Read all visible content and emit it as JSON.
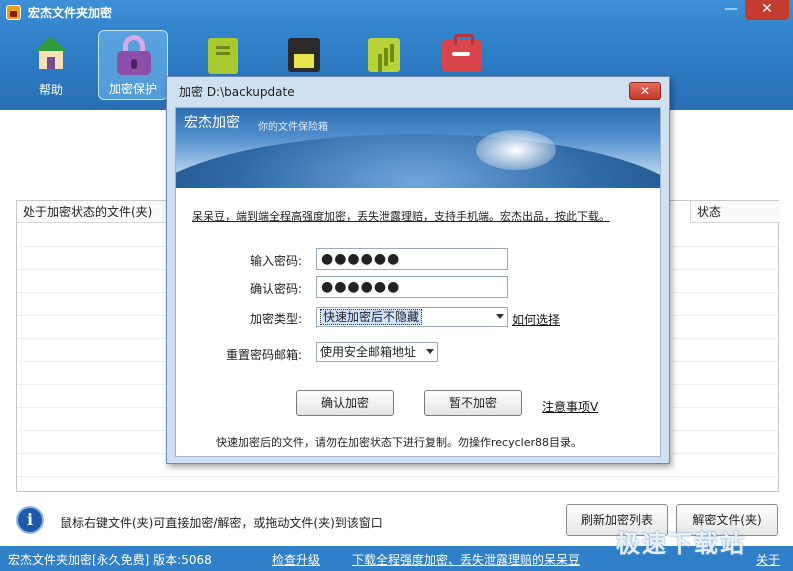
{
  "window": {
    "title": "宏杰文件夹加密",
    "minimize_glyph": "—",
    "close_glyph": "✕"
  },
  "toolbar": {
    "items": [
      {
        "label": "帮助",
        "icon": "house-icon"
      },
      {
        "label": "加密保护",
        "icon": "lock-icon",
        "selected": true
      },
      {
        "label": "",
        "icon": "notebook-icon"
      },
      {
        "label": "",
        "icon": "floppy-disk-icon"
      },
      {
        "label": "",
        "icon": "chart-icon"
      },
      {
        "label": "",
        "icon": "toolbox-icon"
      }
    ]
  },
  "file_table": {
    "columns": [
      "处于加密状态的文件(夹)",
      "状态"
    ],
    "rows": []
  },
  "tip": {
    "icon_glyph": "i",
    "text": "鼠标右键文件(夹)可直接加密/解密，或拖动文件(夹)到该窗口"
  },
  "buttons": {
    "refresh": "刷新加密列表",
    "decrypt": "解密文件(夹)"
  },
  "statusbar": {
    "version": "宏杰文件夹加密[永久免费]  版本:5068",
    "check_update": "检查升级",
    "download": "下载全程强度加密、丢失泄露理赔的呆呆豆",
    "about": "关于"
  },
  "watermark": "极速下载站",
  "dialog": {
    "title": "加密 D:\\backupdate",
    "close_glyph": "✕",
    "banner_title": "宏杰加密",
    "banner_subtitle": "你的文件保险箱",
    "promo": "呆呆豆，端到端全程高强度加密，丢失泄露理赔，支持手机端。宏杰出品，按此下载。",
    "password_label": "输入密码:",
    "password_value": "●●●●●●",
    "confirm_label": "确认密码:",
    "confirm_value": "●●●●●●",
    "type_label": "加密类型:",
    "type_value": "快速加密后不隐藏",
    "how_to_choose": "如何选择",
    "email_label": "重置密码邮箱:",
    "email_value": "使用安全邮箱地址",
    "confirm_button": "确认加密",
    "skip_button": "暂不加密",
    "notes": "注意事项V",
    "note_text": "快速加密后的文件，请勿在加密状态下进行复制。勿操作recycler88目录。"
  },
  "colors": {
    "header_blue": "#2f7fc9",
    "close_red": "#c43c2f",
    "dialog_bg": "#cfe0f0"
  }
}
